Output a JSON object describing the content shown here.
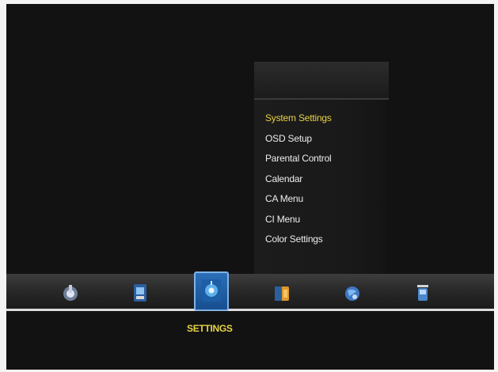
{
  "menu": {
    "items": [
      {
        "label": "System Settings",
        "selected": true
      },
      {
        "label": "OSD Setup",
        "selected": false
      },
      {
        "label": "Parental Control",
        "selected": false
      },
      {
        "label": "Calendar",
        "selected": false
      },
      {
        "label": "CA Menu",
        "selected": false
      },
      {
        "label": "CI Menu",
        "selected": false
      },
      {
        "label": "Color Settings",
        "selected": false
      }
    ]
  },
  "bottom_bar": {
    "icons": [
      "tools-icon",
      "media-icon",
      "settings-icon",
      "folder-icon",
      "globe-icon",
      "trash-icon"
    ],
    "selected_icon": "settings-icon",
    "selected_label": "SETTINGS"
  },
  "colors": {
    "selected_text": "#e8d245",
    "screen_bg": "#121212",
    "selected_icon_bg": "#2a6fb8"
  }
}
